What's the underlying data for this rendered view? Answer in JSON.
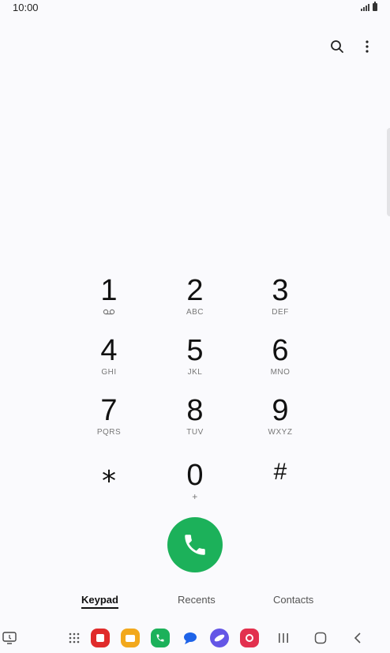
{
  "status_bar": {
    "time": "10:00",
    "icons": [
      "signal-icon",
      "battery-icon"
    ]
  },
  "toolbar": {
    "icons": [
      "search-icon",
      "more-options-icon"
    ]
  },
  "keypad": {
    "keys": [
      {
        "digit": "1",
        "letters": "",
        "icon": "voicemail-icon"
      },
      {
        "digit": "2",
        "letters": "ABC"
      },
      {
        "digit": "3",
        "letters": "DEF"
      },
      {
        "digit": "4",
        "letters": "GHI"
      },
      {
        "digit": "5",
        "letters": "JKL"
      },
      {
        "digit": "6",
        "letters": "MNO"
      },
      {
        "digit": "7",
        "letters": "PQRS"
      },
      {
        "digit": "8",
        "letters": "TUV"
      },
      {
        "digit": "9",
        "letters": "WXYZ"
      },
      {
        "digit": "⁎",
        "letters": ""
      },
      {
        "digit": "0",
        "letters": "+"
      },
      {
        "digit": "#",
        "letters": ""
      }
    ]
  },
  "call_button": {
    "icon": "phone-icon",
    "color": "#1cb15a"
  },
  "tabs": [
    {
      "label": "Keypad",
      "active": true
    },
    {
      "label": "Recents",
      "active": false
    },
    {
      "label": "Contacts",
      "active": false
    }
  ],
  "navbar": {
    "icons": [
      "recent-screen-icon",
      "app-drawer-icon",
      "app-red-icon",
      "files-icon",
      "phone-app-icon",
      "messages-icon",
      "browser-icon",
      "camera-icon",
      "recents-nav-icon",
      "home-nav-icon",
      "back-nav-icon"
    ]
  }
}
